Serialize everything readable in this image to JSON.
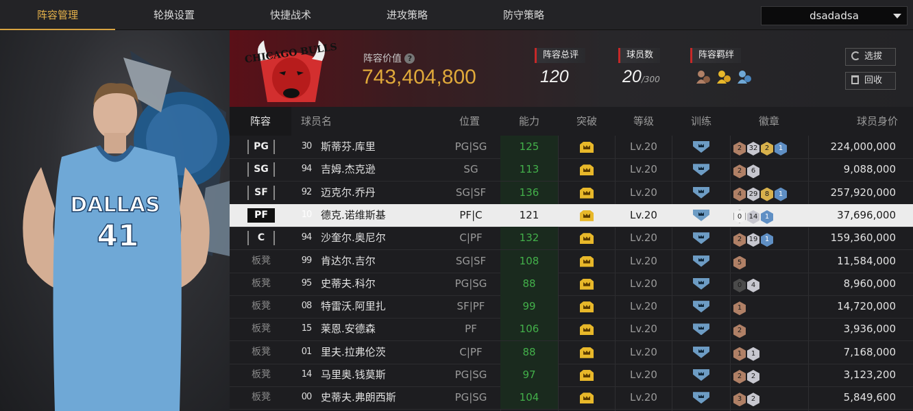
{
  "nav": {
    "tabs": [
      "阵容管理",
      "轮换设置",
      "快捷战术",
      "进攻策略",
      "防守策略"
    ],
    "active_index": 0,
    "team_selector": "dsadadsa"
  },
  "header": {
    "team_logo_text": "CHICAGO BULLS",
    "value_label": "阵容价值",
    "value": "743,404,800",
    "rating_label": "阵容总评",
    "rating": "120",
    "players_label": "球员数",
    "players_count": "20",
    "players_max": "/300",
    "bond_label": "阵容羁绊",
    "scout_button": "选拔",
    "recycle_button": "回收"
  },
  "table": {
    "headers": [
      "阵容",
      "球员名",
      "位置",
      "能力",
      "突破",
      "等级",
      "训练",
      "徽章",
      "球员身价"
    ],
    "rows": [
      {
        "slot": "PG",
        "num": "30",
        "name": "斯蒂芬.库里",
        "pos": "PG|SG",
        "ovr": "125",
        "level": "Lv.20",
        "badges": [
          {
            "c": "bronze",
            "n": "2"
          },
          {
            "c": "silver",
            "n": "32"
          },
          {
            "c": "gold",
            "n": "2"
          },
          {
            "c": "blue",
            "n": "1"
          }
        ],
        "value": "224,000,000",
        "starter": true
      },
      {
        "slot": "SG",
        "num": "94",
        "name": "吉姆.杰克逊",
        "pos": "SG",
        "ovr": "113",
        "level": "Lv.20",
        "badges": [
          {
            "c": "bronze",
            "n": "2"
          },
          {
            "c": "silver",
            "n": "6"
          }
        ],
        "value": "9,088,000",
        "starter": true
      },
      {
        "slot": "SF",
        "num": "92",
        "name": "迈克尔.乔丹",
        "pos": "SG|SF",
        "ovr": "136",
        "level": "Lv.20",
        "badges": [
          {
            "c": "bronze",
            "n": "4"
          },
          {
            "c": "silver",
            "n": "29"
          },
          {
            "c": "gold",
            "n": "8"
          },
          {
            "c": "blue",
            "n": "1"
          }
        ],
        "value": "257,920,000",
        "starter": true
      },
      {
        "slot": "PF",
        "num": "10",
        "name": "德克.诺维斯基",
        "pos": "PF|C",
        "ovr": "121",
        "level": "Lv.20",
        "badges": [
          {
            "c": "light",
            "n": "0"
          },
          {
            "c": "silver",
            "n": "14"
          },
          {
            "c": "blue",
            "n": "1"
          }
        ],
        "value": "37,696,000",
        "starter": true,
        "selected": true
      },
      {
        "slot": "C",
        "num": "94",
        "name": "沙奎尔.奥尼尔",
        "pos": "C|PF",
        "ovr": "132",
        "level": "Lv.20",
        "badges": [
          {
            "c": "bronze",
            "n": "2"
          },
          {
            "c": "silver",
            "n": "19"
          },
          {
            "c": "blue",
            "n": "1"
          }
        ],
        "value": "159,360,000",
        "starter": true
      },
      {
        "slot": "板凳",
        "num": "99",
        "name": "肯达尔.吉尔",
        "pos": "SG|SF",
        "ovr": "108",
        "level": "Lv.20",
        "badges": [
          {
            "c": "bronze",
            "n": "5"
          }
        ],
        "value": "11,584,000",
        "starter": false
      },
      {
        "slot": "板凳",
        "num": "95",
        "name": "史蒂夫.科尔",
        "pos": "PG|SG",
        "ovr": "88",
        "level": "Lv.20",
        "badges": [
          {
            "c": "dark",
            "n": "0"
          },
          {
            "c": "silver",
            "n": "4"
          }
        ],
        "value": "8,960,000",
        "starter": false
      },
      {
        "slot": "板凳",
        "num": "08",
        "name": "特雷沃.阿里扎",
        "pos": "SF|PF",
        "ovr": "99",
        "level": "Lv.20",
        "badges": [
          {
            "c": "bronze",
            "n": "1"
          }
        ],
        "value": "14,720,000",
        "starter": false
      },
      {
        "slot": "板凳",
        "num": "15",
        "name": "莱恩.安德森",
        "pos": "PF",
        "ovr": "106",
        "level": "Lv.20",
        "badges": [
          {
            "c": "bronze",
            "n": "2"
          }
        ],
        "value": "3,936,000",
        "starter": false
      },
      {
        "slot": "板凳",
        "num": "01",
        "name": "里夫.拉弗伦茨",
        "pos": "C|PF",
        "ovr": "88",
        "level": "Lv.20",
        "badges": [
          {
            "c": "bronze",
            "n": "1"
          },
          {
            "c": "silver",
            "n": "1"
          }
        ],
        "value": "7,168,000",
        "starter": false
      },
      {
        "slot": "板凳",
        "num": "14",
        "name": "马里奥.钱莫斯",
        "pos": "PG|SG",
        "ovr": "97",
        "level": "Lv.20",
        "badges": [
          {
            "c": "bronze",
            "n": "2"
          },
          {
            "c": "silver",
            "n": "2"
          }
        ],
        "value": "3,123,200",
        "starter": false
      },
      {
        "slot": "板凳",
        "num": "00",
        "name": "史蒂夫.弗朗西斯",
        "pos": "PG|SG",
        "ovr": "104",
        "level": "Lv.20",
        "badges": [
          {
            "c": "bronze",
            "n": "3"
          },
          {
            "c": "silver",
            "n": "2"
          }
        ],
        "value": "5,849,600",
        "starter": false
      }
    ]
  },
  "featured_player": {
    "team": "DALLAS",
    "jersey": "41"
  },
  "colors": {
    "accent_gold": "#e6b24a",
    "value_gold": "#e0a93a",
    "ovr_green": "#43b04a",
    "bulls_red": "#c62828"
  }
}
